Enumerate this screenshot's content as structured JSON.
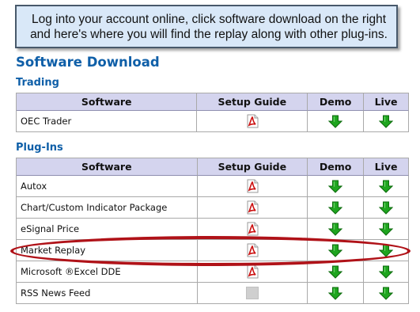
{
  "callout": {
    "text": "Log into your account online, click software download on the right and here's where you will find the replay along with other plug-ins."
  },
  "page_title": "Software Download",
  "trading": {
    "title": "Trading",
    "headers": {
      "software": "Software",
      "guide": "Setup Guide",
      "demo": "Demo",
      "live": "Live"
    },
    "rows": [
      {
        "name": "OEC Trader",
        "guide_icon": "pdf-icon",
        "demo_icon": "download-arrow-icon",
        "live_icon": "download-arrow-icon"
      }
    ]
  },
  "plugins": {
    "title": "Plug-Ins",
    "headers": {
      "software": "Software",
      "guide": "Setup Guide",
      "demo": "Demo",
      "live": "Live"
    },
    "rows": [
      {
        "name": "Autox",
        "guide_icon": "pdf-icon"
      },
      {
        "name": "Chart/Custom Indicator Package",
        "guide_icon": "pdf-icon"
      },
      {
        "name": "eSignal Price",
        "guide_icon": "pdf-icon"
      },
      {
        "name": "Market Replay",
        "guide_icon": "pdf-icon",
        "highlighted": true
      },
      {
        "name": "Microsoft ®Excel DDE",
        "guide_icon": "pdf-icon"
      },
      {
        "name": "RSS News Feed",
        "guide_icon": "blank-icon"
      }
    ]
  },
  "colors": {
    "heading_blue": "#0f5fa8",
    "header_bg": "#d4d4ee",
    "callout_bg": "#d9e8f8",
    "highlight_red": "#b01218",
    "arrow_green": "#1fa51f",
    "pdf_red": "#cc1111"
  }
}
